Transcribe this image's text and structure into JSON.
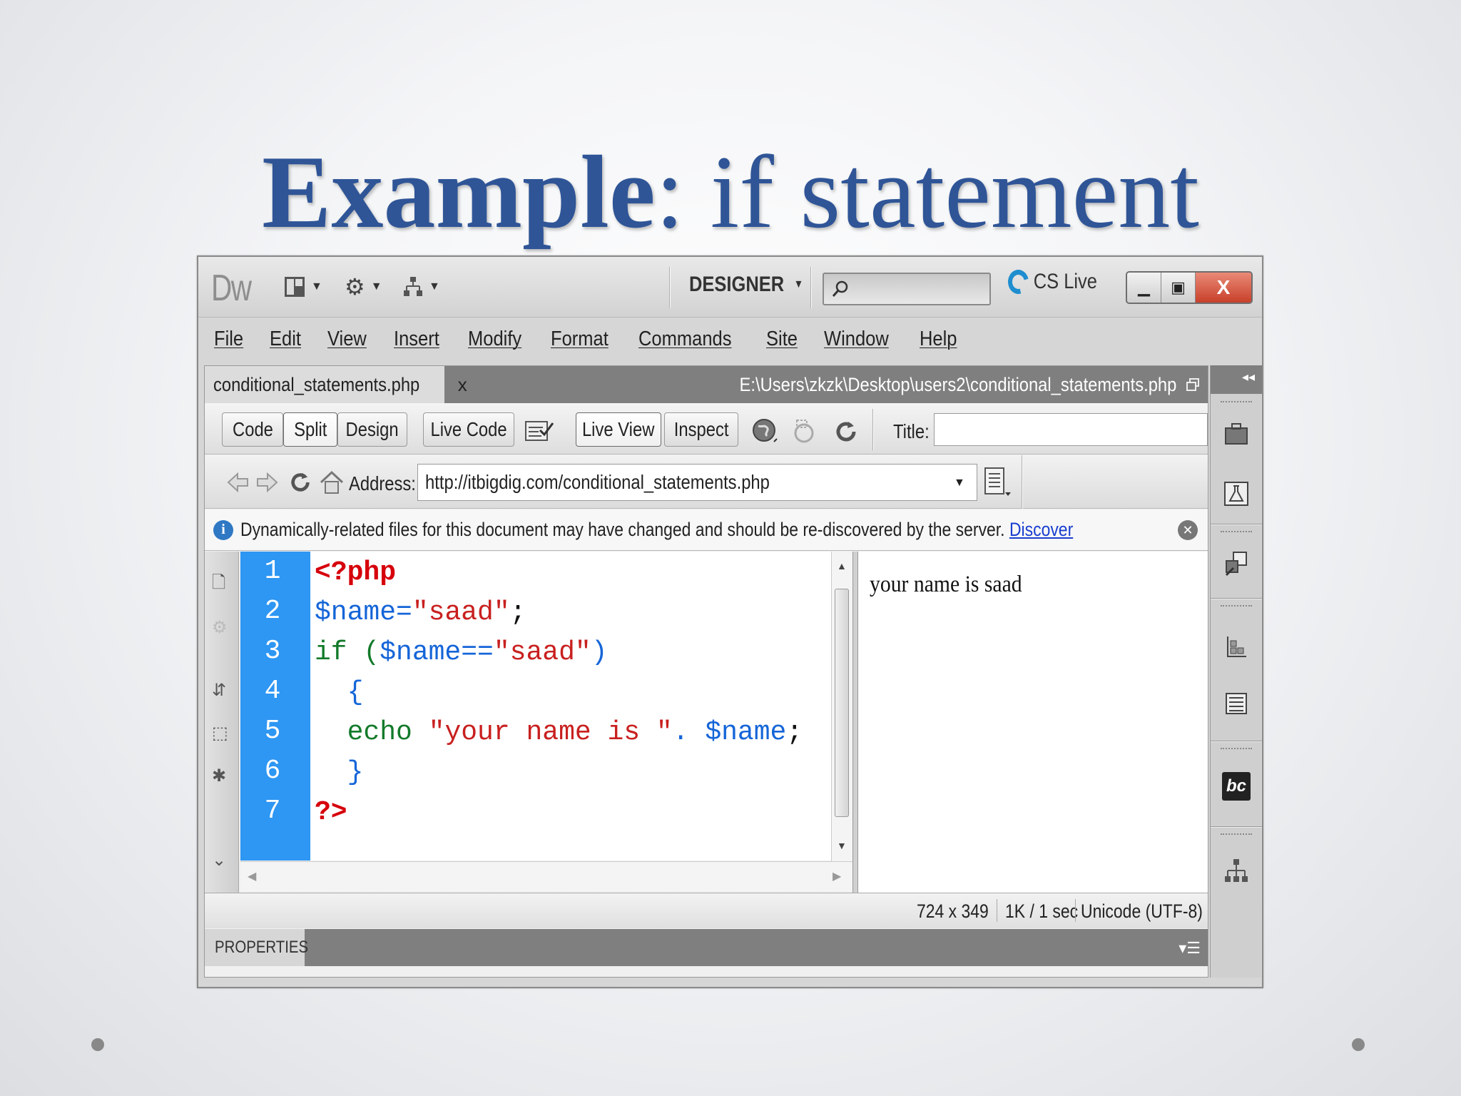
{
  "slide": {
    "title_bold": "Example",
    "title_rest": ": if statement"
  },
  "app": {
    "logo": "Dw",
    "workspace": "DESIGNER",
    "search_placeholder": "",
    "cs_live": "CS Live",
    "close_label": "X"
  },
  "menu": [
    "File",
    "Edit",
    "View",
    "Insert",
    "Modify",
    "Format",
    "Commands",
    "Site",
    "Window",
    "Help"
  ],
  "document": {
    "tab_name": "conditional_statements.php",
    "tab_close": "x",
    "file_path": "E:\\Users\\zkzk\\Desktop\\users2\\conditional_statements.php"
  },
  "toolbar": {
    "code": "Code",
    "split": "Split",
    "design": "Design",
    "live_code": "Live Code",
    "live_view": "Live View",
    "inspect": "Inspect",
    "title_label": "Title:",
    "title_value": ""
  },
  "address": {
    "label": "Address:",
    "url": "http://itbigdig.com/conditional_statements.php"
  },
  "info": {
    "message": "Dynamically-related files for this document may have changed and should be re-discovered by the server.",
    "link": "Discover"
  },
  "code": {
    "line_numbers": [
      "1",
      "2",
      "3",
      "4",
      "5",
      "6",
      "7"
    ],
    "l1": "<?php",
    "l2_var": "$name",
    "l2_eq": "=",
    "l2_str": "\"saad\"",
    "l2_end": ";",
    "l3_if": "if (",
    "l3_var": "$name",
    "l3_op": "==",
    "l3_str": "\"saad\"",
    "l3_end": ")",
    "l4": "  {",
    "l5_echo": "  echo ",
    "l5_str": "\"your name is \"",
    "l5_dot": ". ",
    "l5_var": "$name",
    "l5_end": ";",
    "l6": "  }",
    "l7": "?>"
  },
  "live_output": "your name is saad",
  "status": {
    "size": "724 x 349",
    "download": "1K / 1 sec",
    "encoding": "Unicode (UTF-8)"
  },
  "properties": {
    "label": "PROPERTIES"
  },
  "colors": {
    "title": "#2f5597",
    "gutter": "#2e96f3",
    "keyword": "#d6000b",
    "variable": "#1565d8",
    "string": "#c8201f",
    "function": "#127a2a"
  }
}
